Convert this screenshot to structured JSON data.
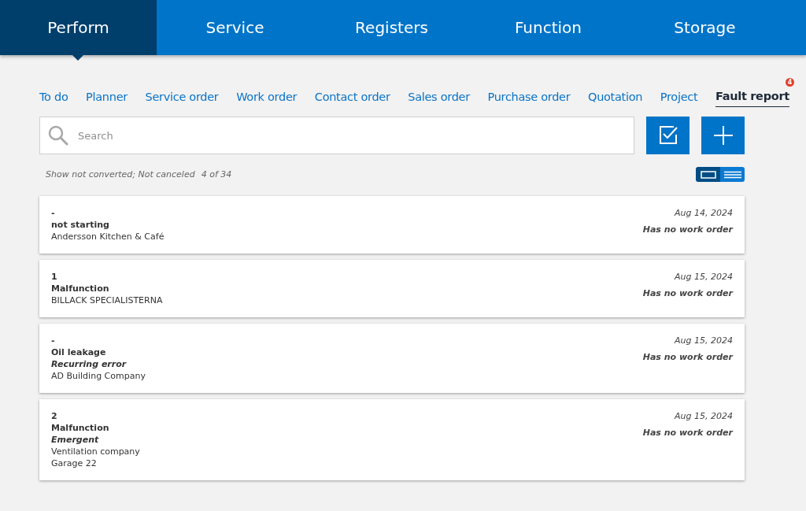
{
  "main_nav": [
    {
      "label": "Perform",
      "selected": true
    },
    {
      "label": "Service",
      "selected": false
    },
    {
      "label": "Registers",
      "selected": false
    },
    {
      "label": "Function",
      "selected": false
    },
    {
      "label": "Storage",
      "selected": false
    }
  ],
  "sub_tabs": [
    {
      "label": "To do",
      "selected": false
    },
    {
      "label": "Planner",
      "selected": false
    },
    {
      "label": "Service order",
      "selected": false
    },
    {
      "label": "Work order",
      "selected": false
    },
    {
      "label": "Contact order",
      "selected": false
    },
    {
      "label": "Sales order",
      "selected": false
    },
    {
      "label": "Purchase order",
      "selected": false
    },
    {
      "label": "Quotation",
      "selected": false
    },
    {
      "label": "Project",
      "selected": false
    },
    {
      "label": "Fault report",
      "selected": true,
      "badge": "4"
    }
  ],
  "search": {
    "placeholder": "Search"
  },
  "filter_summary": {
    "filters": "Show not converted; Not canceled",
    "count": "4 of 34"
  },
  "view_toggle": [
    {
      "kind": "card",
      "selected": true
    },
    {
      "kind": "list",
      "selected": false
    }
  ],
  "reports": [
    {
      "number": "-",
      "title": "not starting",
      "customer": "Andersson Kitchen & Café",
      "date": "Aug 14, 2024",
      "status": "Has no work order"
    },
    {
      "number": "1",
      "title": "Malfunction",
      "customer": "BILLACK SPECIALISTERNA",
      "date": "Aug 15, 2024",
      "status": "Has no work order"
    },
    {
      "number": "-",
      "title": "Oil leakage",
      "priority": "Recurring error",
      "customer": "AD Building Company",
      "date": "Aug 15, 2024",
      "status": "Has no work order"
    },
    {
      "number": "2",
      "title": "Malfunction",
      "priority": "Emergent",
      "customer": "Ventilation company",
      "location": "Garage 22",
      "date": "Aug 15, 2024",
      "status": "Has no work order"
    }
  ]
}
